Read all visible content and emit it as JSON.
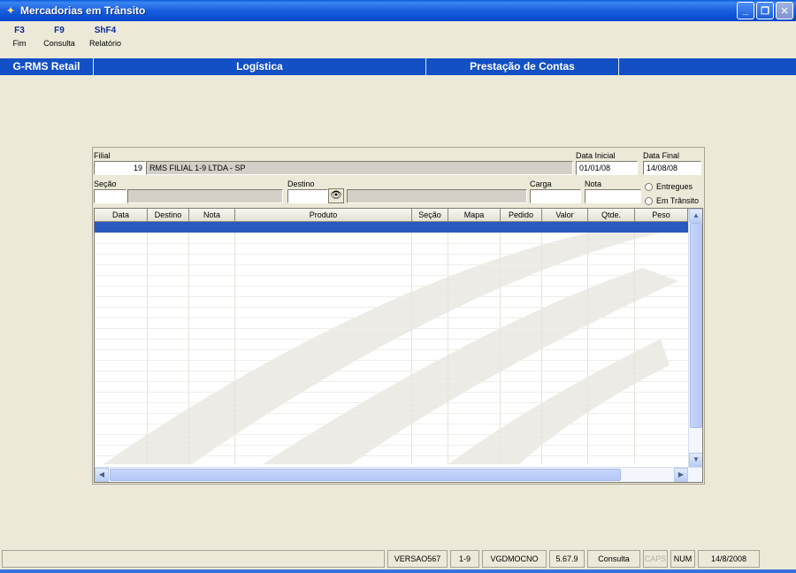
{
  "window": {
    "title": "Mercadorias em Trânsito",
    "buttons": {
      "minimize": "_",
      "restore": "❐",
      "close": "✕"
    }
  },
  "fkeys": [
    {
      "key": "F3",
      "label": "Fim"
    },
    {
      "key": "F9",
      "label": "Consulta"
    },
    {
      "key": "ShF4",
      "label": "Relatório"
    }
  ],
  "menu": [
    "G-RMS Retail",
    "Logística",
    "Prestação de Contas"
  ],
  "form": {
    "filial_label": "Filial",
    "filial_code": "19",
    "filial_name": "RMS FILIAL 1-9 LTDA - SP",
    "data_inicial_label": "Data Inicial",
    "data_inicial": "01/01/08",
    "data_final_label": "Data Final",
    "data_final": "14/08/08",
    "secao_label": "Seção",
    "secao_code": "",
    "secao_name": "",
    "destino_label": "Destino",
    "destino_code": "",
    "destino_name": "",
    "carga_label": "Carga",
    "carga": "",
    "nota_label": "Nota",
    "nota": "",
    "radio_entregues": "Entregues",
    "radio_em_transito": "Em Trânsito"
  },
  "grid": {
    "columns": [
      "Data",
      "Destino",
      "Nota",
      "Produto",
      "Seção",
      "Mapa",
      "Pedido",
      "Valor",
      "Qtde.",
      "Peso"
    ],
    "rows": []
  },
  "icons": {
    "app": "truck-icon",
    "binoculars": "binoculars-icon",
    "scroll_up": "▲",
    "scroll_down": "▼",
    "scroll_left": "◀",
    "scroll_right": "▶"
  },
  "statusbar": [
    "VERSAO567",
    "1-9",
    "VGDMOCNO",
    "5.67.9",
    "Consulta",
    "CAPS",
    "NUM",
    "14/8/2008"
  ],
  "colors": {
    "titlebar": "#0b4fd6",
    "menubar": "#1450c5",
    "selection": "#2a59c0",
    "background": "#ece9d8"
  }
}
